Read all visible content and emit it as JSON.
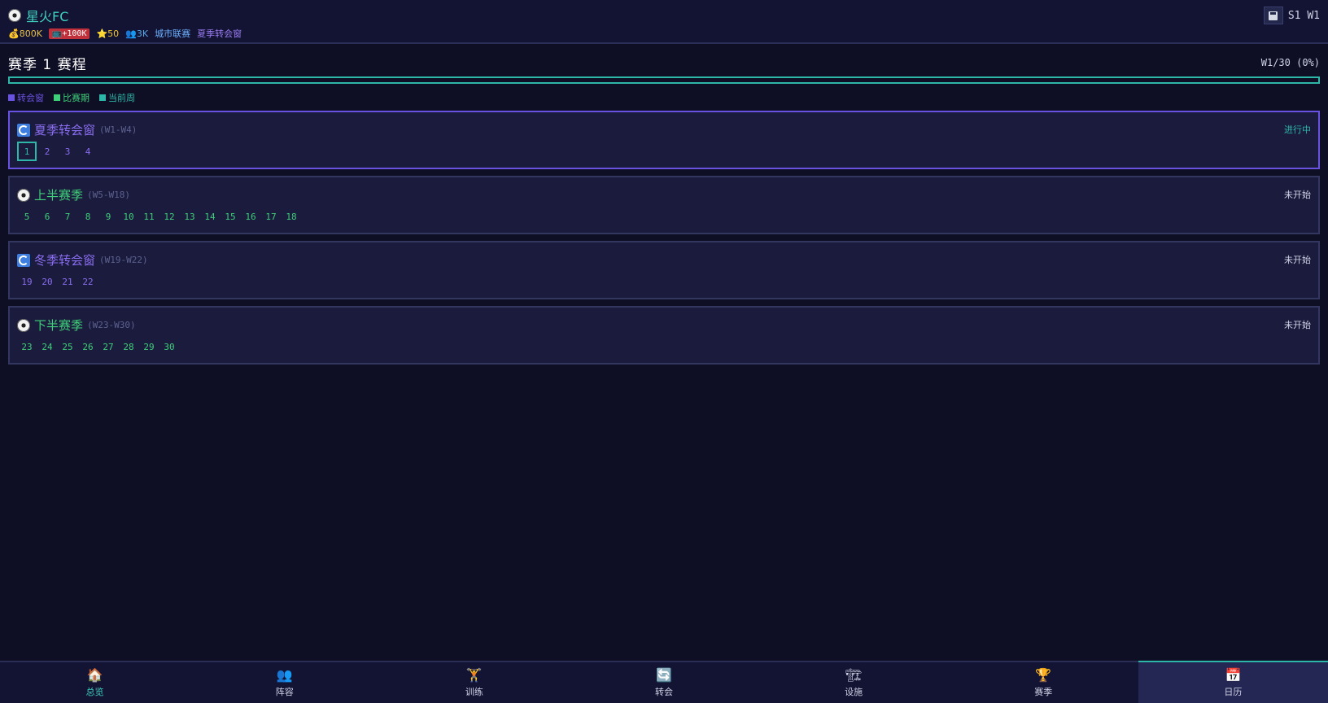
{
  "header": {
    "club_name": "星火FC",
    "money": "💰800K",
    "debt": "📺+100K",
    "reputation": "⭐50",
    "fans": "👥3K",
    "league": "城市联赛",
    "phase": "夏季转会窗",
    "season_week": "S1 W1",
    "icons": {
      "club": "soccer-ball-icon",
      "save": "floppy-disk-icon"
    }
  },
  "main": {
    "title": "赛季 1 赛程",
    "progress_label": "W1/30 (0%)",
    "progress_fraction": 0.0,
    "legend": [
      {
        "label": "转会窗",
        "color": "#6a52e0"
      },
      {
        "label": "比赛期",
        "color": "#3fcf7a"
      },
      {
        "label": "当前周",
        "color": "#2db7a8"
      }
    ],
    "phases": [
      {
        "name": "夏季转会窗",
        "range": "(W1-W4)",
        "status": "进行中",
        "kind": "transfer",
        "color": "#8a6df0",
        "status_color": "#2db7a8",
        "weeks": [
          "1",
          "2",
          "3",
          "4"
        ],
        "current_week": "1"
      },
      {
        "name": "上半赛季",
        "range": "(W5-W18)",
        "status": "未开始",
        "kind": "match",
        "color": "#3fcf7a",
        "status_color": "#cfd3e6",
        "weeks": [
          "5",
          "6",
          "7",
          "8",
          "9",
          "10",
          "11",
          "12",
          "13",
          "14",
          "15",
          "16",
          "17",
          "18"
        ],
        "current_week": ""
      },
      {
        "name": "冬季转会窗",
        "range": "(W19-W22)",
        "status": "未开始",
        "kind": "transfer",
        "color": "#8a6df0",
        "status_color": "#cfd3e6",
        "weeks": [
          "19",
          "20",
          "21",
          "22"
        ],
        "current_week": ""
      },
      {
        "name": "下半赛季",
        "range": "(W23-W30)",
        "status": "未开始",
        "kind": "match",
        "color": "#3fcf7a",
        "status_color": "#cfd3e6",
        "weeks": [
          "23",
          "24",
          "25",
          "26",
          "27",
          "28",
          "29",
          "30"
        ],
        "current_week": ""
      }
    ]
  },
  "nav": [
    {
      "label": "总览",
      "icon": "🏠",
      "icon_name": "home-icon"
    },
    {
      "label": "阵容",
      "icon": "👥",
      "icon_name": "squad-icon"
    },
    {
      "label": "训练",
      "icon": "🏋",
      "icon_name": "training-icon"
    },
    {
      "label": "转会",
      "icon": "🔄",
      "icon_name": "transfer-icon"
    },
    {
      "label": "设施",
      "icon": "🏗",
      "icon_name": "facility-icon"
    },
    {
      "label": "赛季",
      "icon": "🏆",
      "icon_name": "trophy-icon"
    },
    {
      "label": "日历",
      "icon": "📅",
      "icon_name": "calendar-icon"
    }
  ],
  "nav_selected": "日历"
}
